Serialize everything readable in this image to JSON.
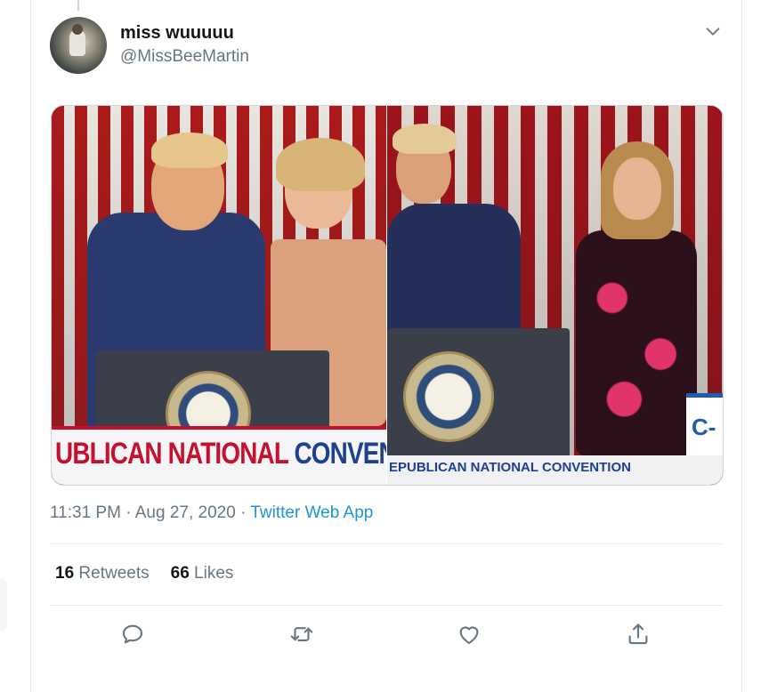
{
  "tweet": {
    "display_name": "miss wuuuuu",
    "handle": "@MissBeeMartin",
    "timestamp": "11:31 PM · Aug 27, 2020 · ",
    "source": "Twitter Web App"
  },
  "media": {
    "left_banner_red": "UBLICAN NATIONAL ",
    "left_banner_blue": "CONVEN",
    "right_banner": "EPUBLICAN NATIONAL CONVENTION",
    "network_logo": "C-"
  },
  "stats": {
    "retweets_count": "16",
    "retweets_label": "Retweets",
    "likes_count": "66",
    "likes_label": "Likes"
  },
  "icons": {
    "caret": "chevron-down-icon",
    "reply": "reply-icon",
    "retweet": "retweet-icon",
    "like": "heart-icon",
    "share": "share-icon"
  },
  "colors": {
    "link": "#1b95e0",
    "muted": "#657786",
    "text": "#14171a",
    "border": "#e6ecf0"
  }
}
